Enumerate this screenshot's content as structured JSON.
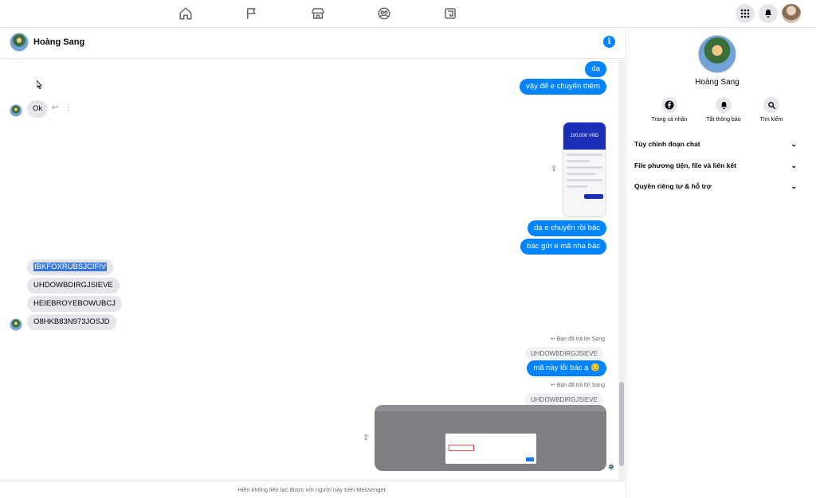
{
  "nav": {
    "icons": [
      "home-icon",
      "flag-icon",
      "marketplace-icon",
      "groups-icon",
      "gaming-icon"
    ],
    "right": [
      "apps-grid-icon",
      "bell-icon",
      "profile-avatar"
    ]
  },
  "chat": {
    "name": "Hoàng Sang",
    "footer": "Hiện không liên lạc được với người này trên Messenger."
  },
  "messages": {
    "out1": "dạ",
    "out2": "vậy để e chuyển thêm",
    "in_ok": "Ok",
    "phone_amount": "100,000 VND",
    "out3": "dạ e chuyển rồi bác",
    "out4": "bác gửi e mã nha bác",
    "code1": "IBKFOXRUBSJCIFIV",
    "code2": "UHDOWBDIRGJSIEVE",
    "code3": "HEIEBROYEBOWUBCJ",
    "code4": "O8HKB83N973JOSJD",
    "reply_meta1": "Bạn đã trả lời Sang",
    "reply_quote1": "UHDOWBDIRGJSIEVE",
    "out5": "mã này lỗi bác ạ 😔",
    "reply_meta2": "Bạn đã trả lời Sang",
    "reply_quote2": "UHDOWBDIRGJSIEVE"
  },
  "panel": {
    "name": "Hoàng Sang",
    "actions": {
      "profile": "Trang cá nhân",
      "mute": "Tắt thông báo",
      "search": "Tìm kiếm"
    },
    "sections": {
      "customize": "Tùy chỉnh đoạn chat",
      "media": "File phương tiện, file và liên kết",
      "privacy": "Quyền riêng tư & hỗ trợ"
    }
  }
}
